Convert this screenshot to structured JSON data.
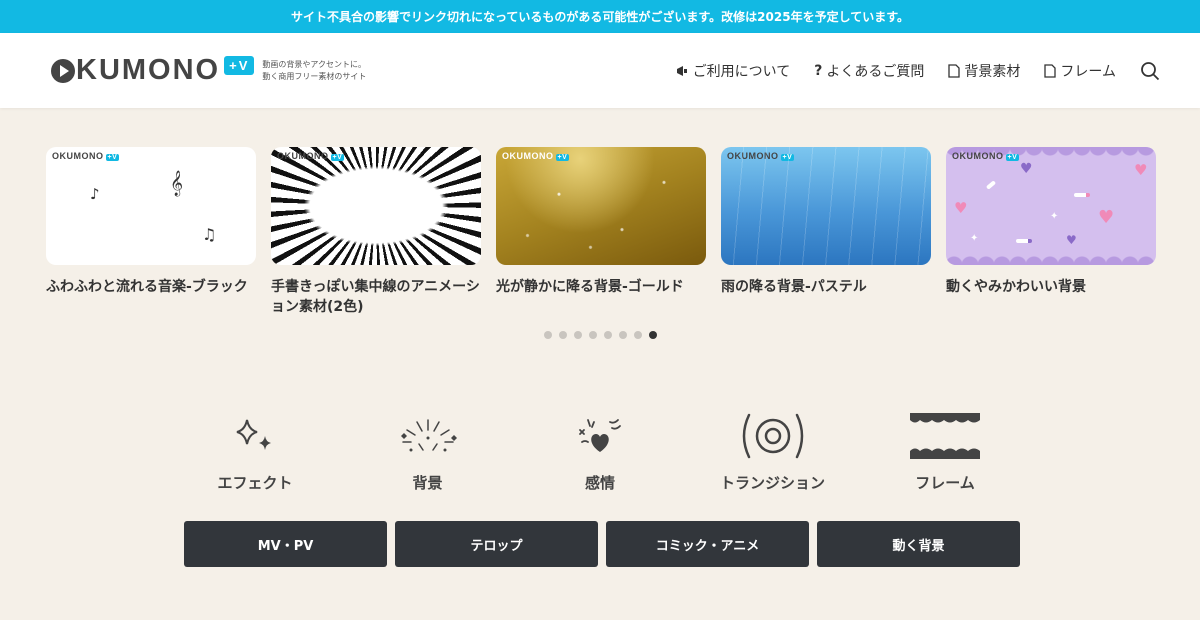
{
  "notice": "サイト不具合の影響でリンク切れになっているものがある可能性がございます。改修は2025年を予定しています。",
  "logo": {
    "word": "KUMONO",
    "badge": "+V",
    "tagline_1": "動画の背景やアクセントに。",
    "tagline_2": "動く商用フリー素材のサイト"
  },
  "nav": [
    {
      "label": "ご利用について",
      "icon": "megaphone-icon"
    },
    {
      "label": "よくあるご質問",
      "icon": "question-icon"
    },
    {
      "label": "背景素材",
      "icon": "document-icon"
    },
    {
      "label": "フレーム",
      "icon": "document-icon"
    }
  ],
  "thumb_logo": {
    "word": "OKUMONO",
    "badge": "+V"
  },
  "cards": [
    {
      "title": "ふわふわと流れる音楽-ブラック"
    },
    {
      "title": "手書きっぽい集中線のアニメーション素材(2色)"
    },
    {
      "title": "光が静かに降る背景-ゴールド"
    },
    {
      "title": "雨の降る背景-パステル"
    },
    {
      "title": "動くやみかわいい背景"
    }
  ],
  "carousel": {
    "total": 8,
    "active_index": 7
  },
  "categories": [
    {
      "label": "エフェクト",
      "icon": "sparkle-icon"
    },
    {
      "label": "背景",
      "icon": "confetti-icon"
    },
    {
      "label": "感情",
      "icon": "emotion-heart-icon"
    },
    {
      "label": "トランジション",
      "icon": "circle-target-icon"
    },
    {
      "label": "フレーム",
      "icon": "frame-wave-icon"
    }
  ],
  "tags": [
    "MV・PV",
    "テロップ",
    "コミック・アニメ",
    "動く背景"
  ],
  "colors": {
    "accent": "#12b9e3",
    "background": "#f5f0e8",
    "tag_bg": "#32363b"
  }
}
